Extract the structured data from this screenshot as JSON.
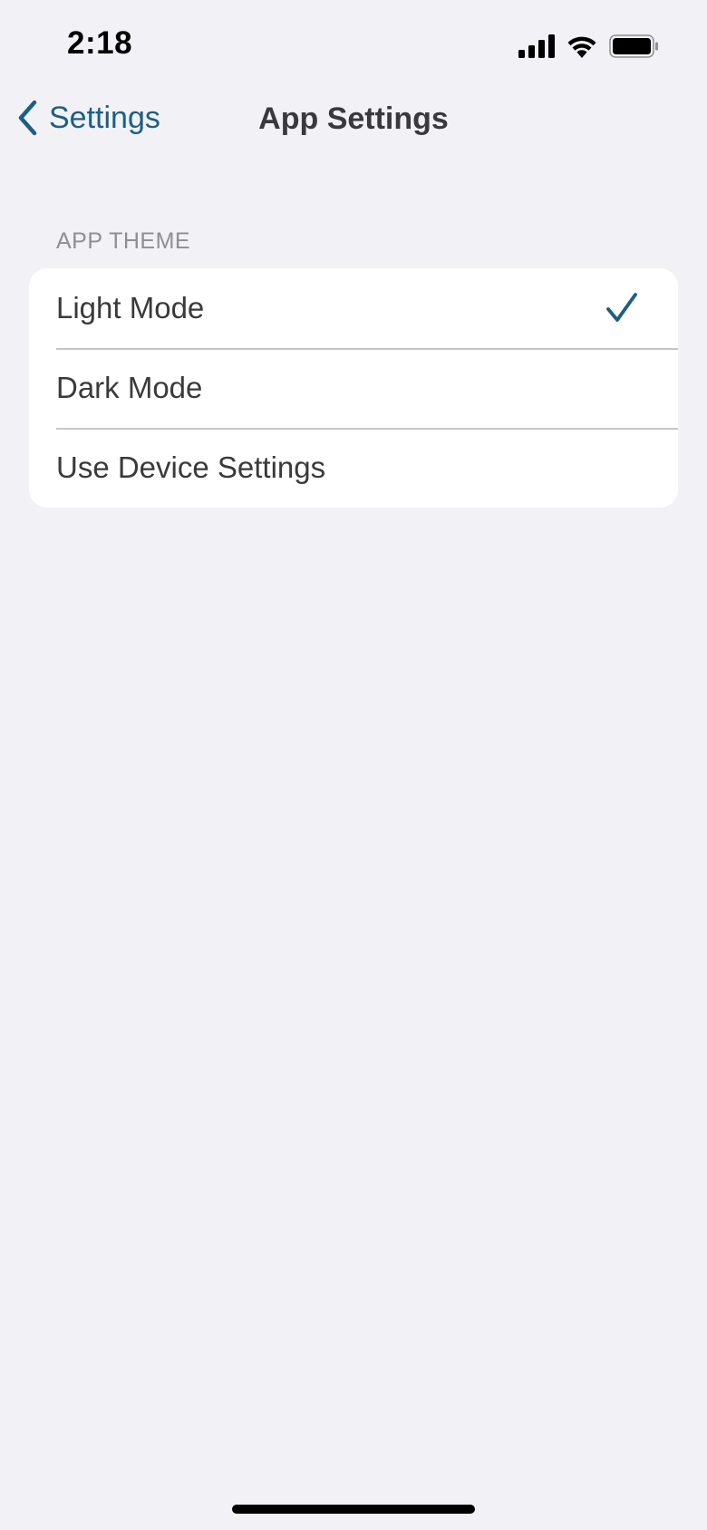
{
  "status_bar": {
    "time": "2:18"
  },
  "nav": {
    "back_label": "Settings",
    "title": "App Settings"
  },
  "theme_section": {
    "header": "APP THEME",
    "options": [
      {
        "label": "Light Mode",
        "selected": true
      },
      {
        "label": "Dark Mode",
        "selected": false
      },
      {
        "label": "Use Device Settings",
        "selected": false
      }
    ]
  },
  "colors": {
    "accent": "#1c5f84",
    "background": "#f1f1f6",
    "text": "#3a3a3c",
    "secondary_text": "#8e8e93"
  },
  "icons": {
    "back": "chevron-left-icon",
    "selected": "checkmark-icon",
    "signal": "cellular-signal-icon",
    "wifi": "wifi-icon",
    "battery": "battery-icon"
  }
}
